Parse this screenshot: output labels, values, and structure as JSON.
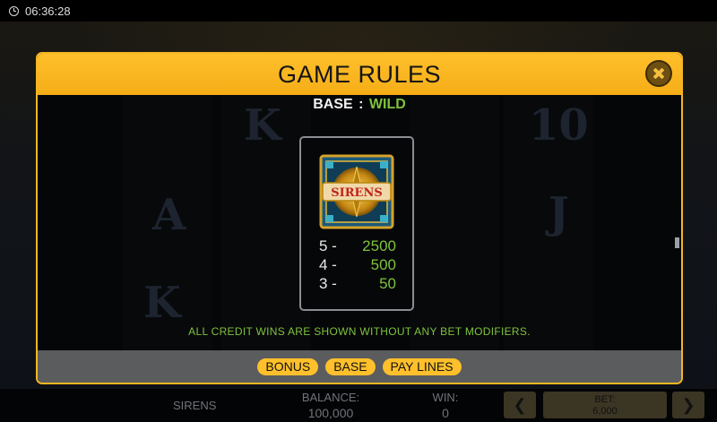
{
  "status_bar": {
    "time": "06:36:28"
  },
  "modal": {
    "title": "GAME RULES",
    "heading_prefix": "BASE",
    "heading_separator": ":",
    "heading_subject": "WILD",
    "symbol_logo_text": "SIRENS",
    "paytable": [
      {
        "count": "5 -",
        "amount": "2500"
      },
      {
        "count": "4 -",
        "amount": "500"
      },
      {
        "count": "3 -",
        "amount": "50"
      }
    ],
    "note": "ALL CREDIT WINS ARE SHOWN WITHOUT ANY BET MODIFIERS.",
    "tabs": [
      "BONUS",
      "BASE",
      "PAY LINES"
    ]
  },
  "game_bar": {
    "game_name": "SIRENS",
    "balance_label": "BALANCE:",
    "balance_value": "100,000",
    "win_label": "WIN:",
    "win_value": "0",
    "bet_label": "BET:",
    "bet_value": "6,000",
    "prev_icon": "chevron-left-icon",
    "next_icon": "chevron-right-icon"
  },
  "colors": {
    "accent_gold": "#ffc02b",
    "win_green": "#7ec33d"
  }
}
